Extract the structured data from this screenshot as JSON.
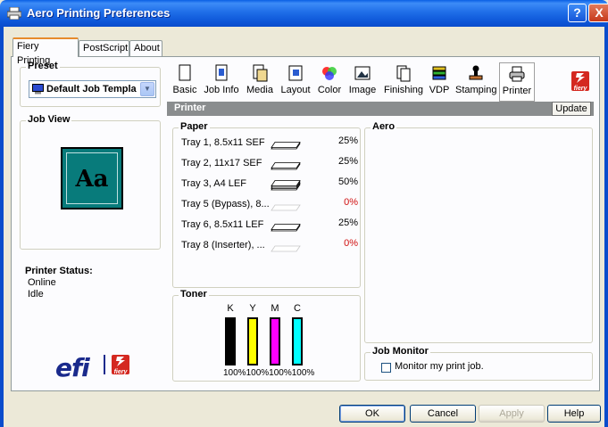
{
  "window": {
    "title": "Aero Printing Preferences",
    "help": "?",
    "close": "X"
  },
  "tabs": [
    "Fiery Printing",
    "PostScript",
    "About"
  ],
  "preset": {
    "title": "Preset",
    "value": "Default Job Templa"
  },
  "job_view": {
    "title": "Job View",
    "preview_text": "Aa"
  },
  "printer_status": {
    "label": "Printer Status:",
    "lines": [
      "Online",
      "Idle"
    ]
  },
  "branding": {
    "efi": "efi",
    "fiery": "fiery"
  },
  "toolbar": [
    "Basic",
    "Job Info",
    "Media",
    "Layout",
    "Color",
    "Image",
    "Finishing",
    "VDP",
    "Stamping",
    "Printer"
  ],
  "section": {
    "title": "Printer",
    "update": "Update"
  },
  "paper": {
    "title": "Paper",
    "trays": [
      {
        "name": "Tray 1, 8.5x11 SEF",
        "pct": "25%",
        "level": 0.25,
        "pct_color": "#000000"
      },
      {
        "name": "Tray 2, 11x17 SEF",
        "pct": "25%",
        "level": 0.25,
        "pct_color": "#000000"
      },
      {
        "name": "Tray 3, A4 LEF",
        "pct": "50%",
        "level": 0.5,
        "pct_color": "#000000"
      },
      {
        "name": "Tray 5 (Bypass), 8...",
        "pct": "0%",
        "level": 0,
        "pct_color": "#d01010"
      },
      {
        "name": "Tray 6, 8.5x11 LEF",
        "pct": "25%",
        "level": 0.25,
        "pct_color": "#000000"
      },
      {
        "name": "Tray 8 (Inserter), ...",
        "pct": "0%",
        "level": 0,
        "pct_color": "#d01010"
      }
    ]
  },
  "toner": {
    "title": "Toner",
    "colors": [
      {
        "label": "K",
        "color": "#000000",
        "level": 1.0
      },
      {
        "label": "Y",
        "color": "#ffff00",
        "level": 1.0
      },
      {
        "label": "M",
        "color": "#ff00ff",
        "level": 1.0
      },
      {
        "label": "C",
        "color": "#00ffff",
        "level": 1.0
      }
    ],
    "percent_text": "100%100%100%100%"
  },
  "aero": {
    "title": "Aero"
  },
  "job_monitor": {
    "title": "Job Monitor",
    "checkbox_label": "Monitor my print job.",
    "checked": false
  },
  "buttons": {
    "ok": "OK",
    "cancel": "Cancel",
    "apply": "Apply",
    "help": "Help"
  }
}
